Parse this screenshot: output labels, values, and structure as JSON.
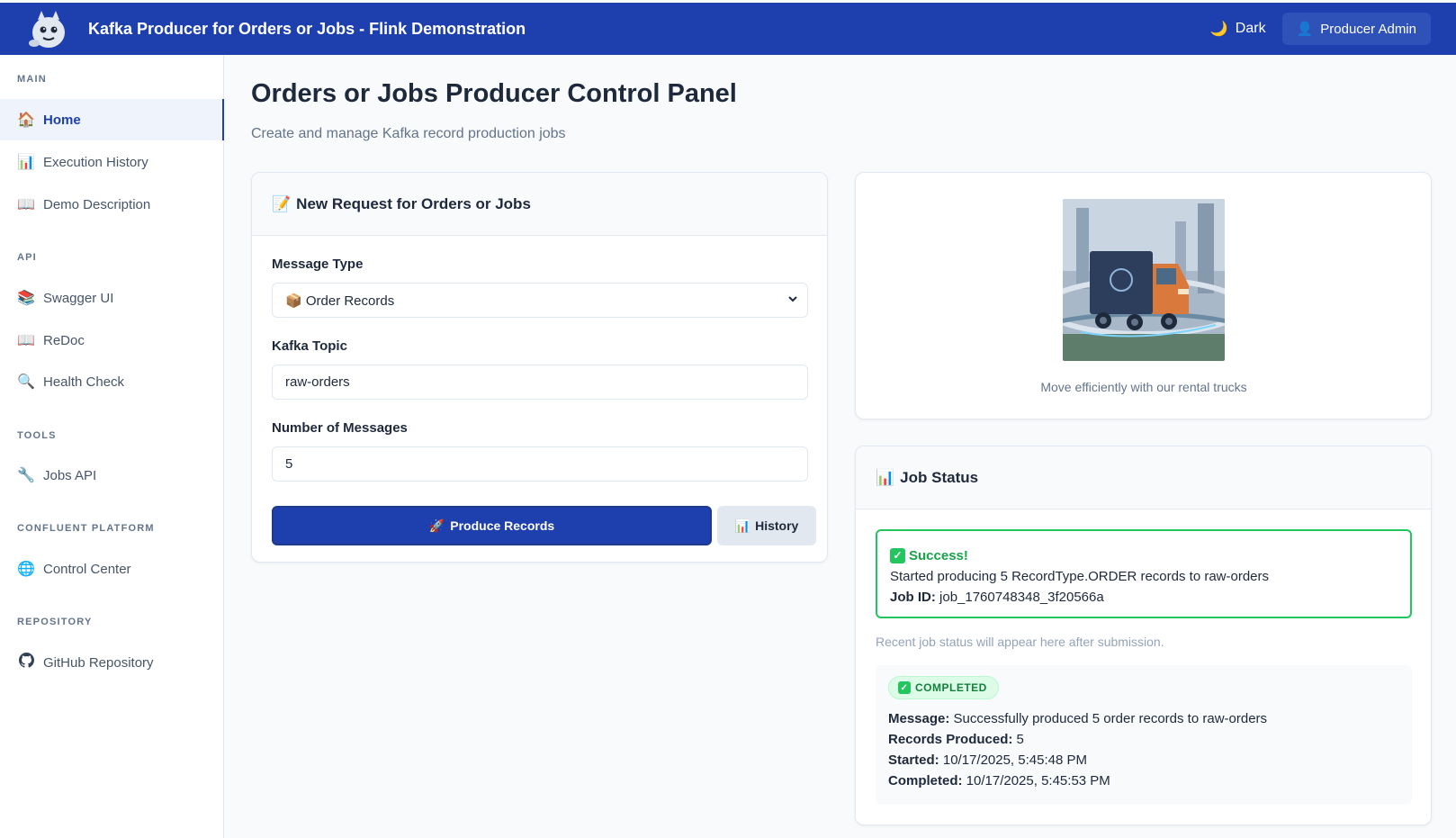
{
  "header": {
    "title": "Kafka Producer for Orders or Jobs - Flink Demonstration",
    "theme_icon": "🌙",
    "theme_label": "Dark",
    "user_icon": "👤",
    "user_label": "Producer Admin",
    "bg_color": "#1e40af"
  },
  "sidebar": {
    "sections": {
      "main": "MAIN",
      "api": "API",
      "tools": "TOOLS",
      "confluent": "CONFLUENT PLATFORM",
      "repository": "REPOSITORY"
    },
    "items": [
      {
        "icon": "🏠",
        "label": "Home",
        "active": true
      },
      {
        "icon": "📊",
        "label": "Execution History"
      },
      {
        "icon": "📖",
        "label": "Demo Description"
      },
      {
        "icon": "📚",
        "label": "Swagger UI"
      },
      {
        "icon": "📖",
        "label": "ReDoc"
      },
      {
        "icon": "🔍",
        "label": "Health Check"
      },
      {
        "icon": "🔧",
        "label": "Jobs API"
      },
      {
        "icon": "🌐",
        "label": "Control Center"
      },
      {
        "icon": "github-icon",
        "label": "GitHub Repository"
      }
    ]
  },
  "main": {
    "title": "Orders or Jobs Producer Control Panel",
    "subtitle": "Create and manage Kafka record production jobs"
  },
  "form": {
    "header_icon": "📝",
    "header": "New Request for Orders or Jobs",
    "message_type_label": "Message Type",
    "message_type_value": "📦 Order Records",
    "topic_label": "Kafka Topic",
    "topic_value": "raw-orders",
    "count_label": "Number of Messages",
    "count_value": "5",
    "produce_icon": "🚀",
    "produce_label": "Produce Records",
    "history_icon": "📊",
    "history_label": "History"
  },
  "image_card": {
    "caption": "Move efficiently with our rental trucks"
  },
  "job_status": {
    "header_icon": "📊",
    "header": "Job Status",
    "alert_title": "Success!",
    "alert_message": "Started producing 5 RecordType.ORDER records to raw-orders",
    "job_id_label": "Job ID:",
    "job_id_value": "job_1760748348_3f20566a",
    "note": "Recent job status will appear here after submission.",
    "badge": "COMPLETED",
    "message_label": "Message:",
    "message_value": "Successfully produced 5 order records to raw-orders",
    "records_label": "Records Produced:",
    "records_value": "5",
    "started_label": "Started:",
    "started_value": "10/17/2025, 5:45:48 PM",
    "completed_label": "Completed:",
    "completed_value": "10/17/2025, 5:45:53 PM"
  }
}
